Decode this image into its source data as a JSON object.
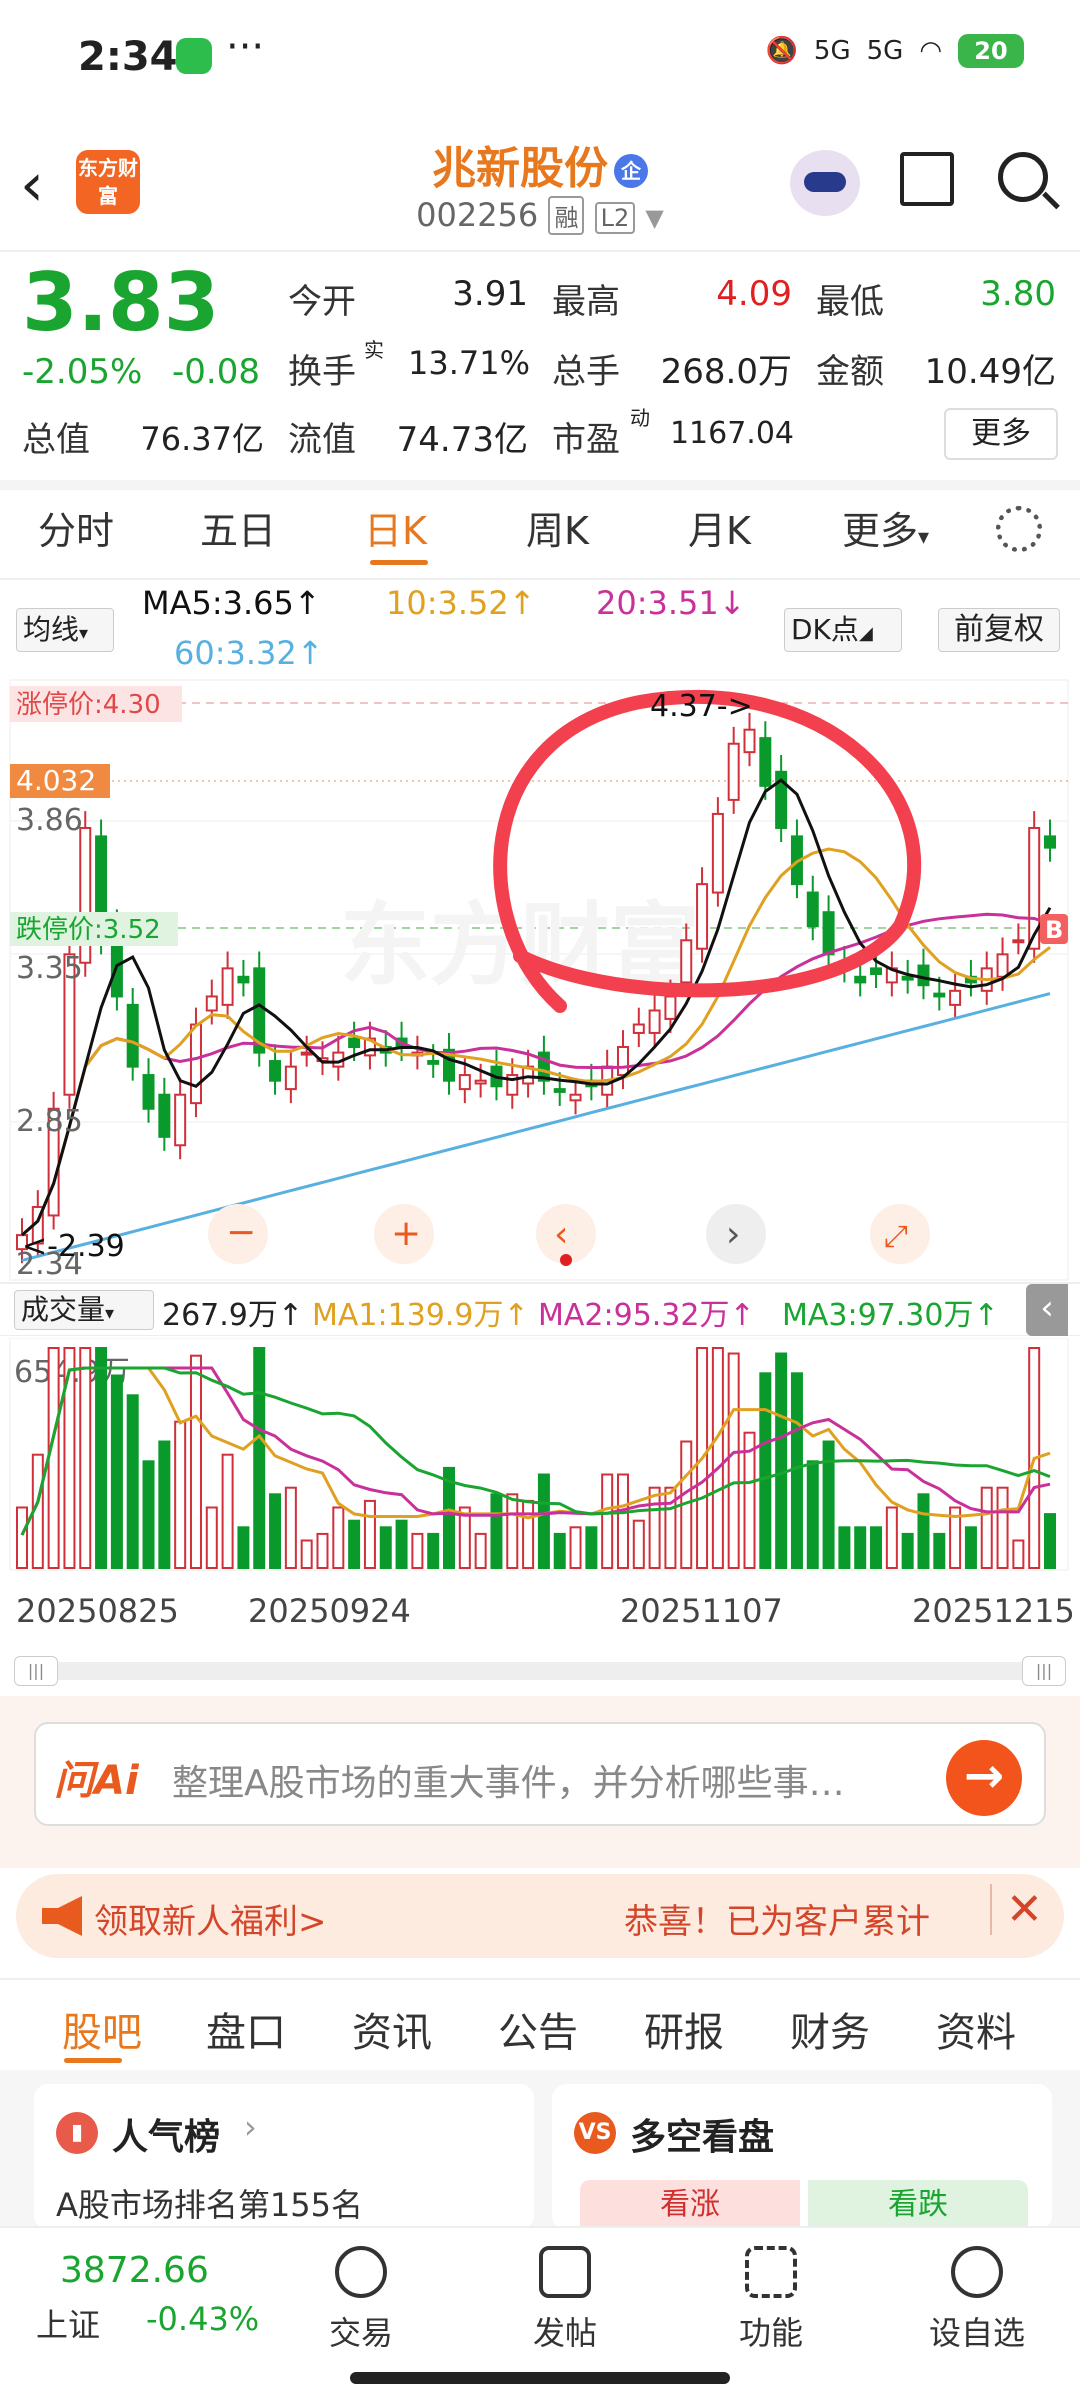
{
  "status_bar": {
    "time": "2:34",
    "dots": "···",
    "signal1": "5G",
    "signal2": "5G",
    "battery": "20"
  },
  "header": {
    "logo": "东方财富",
    "stock_name": "兆新股份",
    "qi_badge": "企",
    "stock_code": "002256",
    "tag_rong": "融",
    "tag_l2": "L2"
  },
  "quote": {
    "price": "3.83",
    "change_pct": "-2.05%",
    "change_abs": "-0.08",
    "today_open_label": "今开",
    "today_open": "3.91",
    "high_label": "最高",
    "high": "4.09",
    "low_label": "最低",
    "low": "3.80",
    "turnover_label": "换手",
    "turnover_sup": "实",
    "turnover": "13.71%",
    "volume_label": "总手",
    "volume": "268.0万",
    "amount_label": "金额",
    "amount": "10.49亿",
    "total_mv_label": "总值",
    "total_mv": "76.37亿",
    "float_mv_label": "流值",
    "float_mv": "74.73亿",
    "pe_label": "市盈",
    "pe_sup": "动",
    "pe": "1167.04",
    "more": "更多"
  },
  "ktabs": [
    "分时",
    "五日",
    "日K",
    "周K",
    "月K",
    "更多"
  ],
  "ktab_active": "日K",
  "ma_legend": {
    "selector": "均线",
    "ma5": "MA5:3.65↑",
    "ma10": "10:3.52↑",
    "ma20": "20:3.51↓",
    "ma60": "60:3.32↑",
    "dk": "DK点",
    "fq": "前复权"
  },
  "chart_labels": {
    "limit_up": "涨停价:4.30",
    "limit_down": "跌停价:3.52",
    "cur_price": "4.032",
    "y_3_86": "3.86",
    "y_3_35": "3.35",
    "y_2_85": "2.85",
    "y_2_34": "2.34",
    "y_4_37": "4.37",
    "high_marker": "4.37->",
    "low_marker": "<-2.39",
    "b_marker": "B",
    "watermark": "东方财富"
  },
  "volume": {
    "selector": "成交量",
    "current": "267.9万↑",
    "ma1": "MA1:139.9万↑",
    "ma2": "MA2:95.32万↑",
    "ma3": "MA3:97.30万↑",
    "max_label": "654.9万"
  },
  "dates": [
    "20250825",
    "20250924",
    "20251107",
    "20251215"
  ],
  "ai": {
    "logo": "问Ai",
    "placeholder": "整理A股市场的重大事件，并分析哪些事…",
    "go": "→"
  },
  "promo": {
    "left": "领取新人福利>",
    "right": "恭喜！已为客户累计",
    "close": "✕"
  },
  "bottom_tabs": [
    "股吧",
    "盘口",
    "资讯",
    "公告",
    "研报",
    "财务",
    "资料"
  ],
  "bottom_tab_active": "股吧",
  "cards": {
    "popularity_title": "人气榜",
    "popularity_sub": "A股市场排名第155名",
    "bullbear_title": "多空看盘",
    "bull": "看涨",
    "bear": "看跌"
  },
  "bottom_nav": {
    "index_value": "3872.66",
    "index_name": "上证",
    "index_change": "-0.43%",
    "items": [
      "交易",
      "发帖",
      "功能",
      "设自选"
    ]
  },
  "chart_data": {
    "type": "candlestick",
    "y_ticks": [
      4.37,
      3.86,
      3.35,
      2.85,
      2.34
    ],
    "levels": {
      "limit_up": 4.3,
      "limit_down": 3.52,
      "current": 4.032
    },
    "high": 4.37,
    "low": 2.39,
    "last_ma": {
      "MA5": 3.65,
      "MA10": 3.52,
      "MA20": 3.51,
      "MA60": 3.32
    },
    "x_labels": [
      "20250825",
      "20250924",
      "20251107",
      "20251215"
    ],
    "volume_max": "654.9万",
    "colors": {
      "up": "#d0303a",
      "down": "#0a9a2c",
      "ma5": "#111111",
      "ma10": "#e0a020",
      "ma20": "#c8309a",
      "ma60": "#58b0e0"
    }
  }
}
